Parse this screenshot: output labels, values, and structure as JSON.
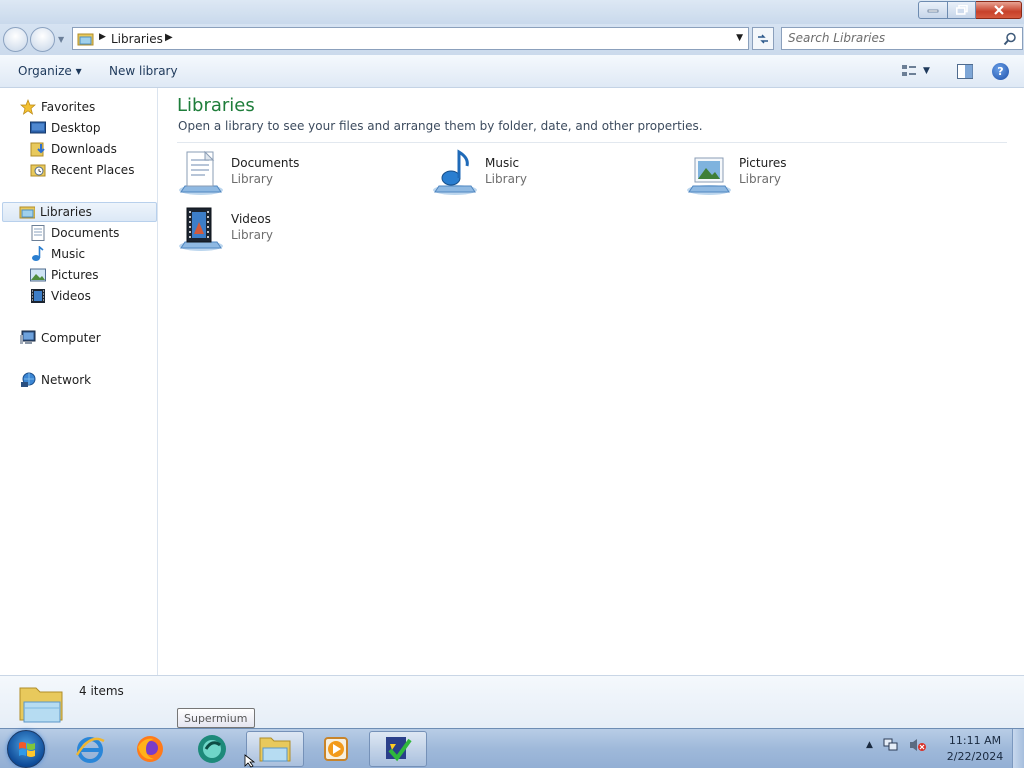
{
  "window": {
    "controls": {
      "minimize_icon": "minimize-icon",
      "maximize_icon": "restore-icon",
      "close_icon": "close-icon"
    }
  },
  "address": {
    "path": "Libraries",
    "search_placeholder": "Search Libraries"
  },
  "toolbar": {
    "organize_label": "Organize ▾",
    "new_library_label": "New library"
  },
  "nav": {
    "favorites": {
      "label": "Favorites",
      "items": [
        {
          "label": "Desktop",
          "icon": "desktop-icon"
        },
        {
          "label": "Downloads",
          "icon": "downloads-icon"
        },
        {
          "label": "Recent Places",
          "icon": "recent-places-icon"
        }
      ]
    },
    "libraries": {
      "label": "Libraries",
      "items": [
        {
          "label": "Documents",
          "icon": "documents-icon"
        },
        {
          "label": "Music",
          "icon": "music-icon"
        },
        {
          "label": "Pictures",
          "icon": "pictures-icon"
        },
        {
          "label": "Videos",
          "icon": "videos-icon"
        }
      ]
    },
    "computer": {
      "label": "Computer"
    },
    "network": {
      "label": "Network"
    }
  },
  "content": {
    "title": "Libraries",
    "subtitle": "Open a library to see your files and arrange them by folder, date, and other properties.",
    "libraries": [
      {
        "name": "Documents",
        "type": "Library",
        "icon": "documents-library-icon"
      },
      {
        "name": "Music",
        "type": "Library",
        "icon": "music-library-icon"
      },
      {
        "name": "Pictures",
        "type": "Library",
        "icon": "pictures-library-icon"
      },
      {
        "name": "Videos",
        "type": "Library",
        "icon": "videos-library-icon"
      }
    ]
  },
  "details": {
    "item_count": "4 items"
  },
  "tooltip": {
    "text": "Supermium"
  },
  "taskbar": {
    "apps": [
      "internet-explorer",
      "firefox",
      "supermium",
      "windows-explorer",
      "media-player",
      "task-app"
    ],
    "clock_time": "11:11 AM",
    "clock_date": "2/22/2024"
  },
  "colors": {
    "title_green": "#1e7d3a",
    "accent_blue": "#1e395b"
  }
}
